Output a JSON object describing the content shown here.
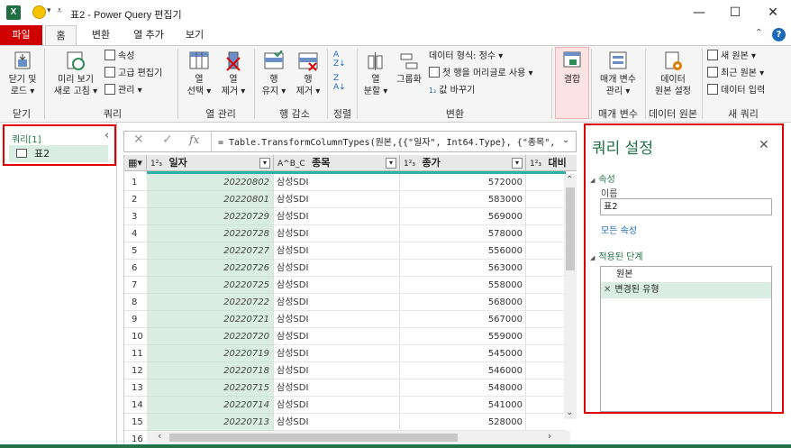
{
  "window": {
    "logo": "X",
    "title": "표2 - Power Query 편집기",
    "controls": {
      "minimize": "—",
      "maximize": "☐",
      "close": "✕"
    }
  },
  "tabs": [
    {
      "label": "파일"
    },
    {
      "label": "홈"
    },
    {
      "label": "변환"
    },
    {
      "label": "열 추가"
    },
    {
      "label": "보기"
    }
  ],
  "ribbon": {
    "close_group": {
      "btn_line1": "닫기 및",
      "btn_line2": "로드 ▾",
      "label": "닫기"
    },
    "query_group": {
      "preview_line1": "미리 보기",
      "preview_line2": "새로 고침 ▾",
      "properties": "속성",
      "advanced_editor": "고급 편집기",
      "manage": "관리 ▾",
      "label": "쿼리"
    },
    "column_group": {
      "select_line1": "열",
      "select_line2": "선택 ▾",
      "remove_line1": "열",
      "remove_line2": "제거 ▾",
      "label": "열 관리"
    },
    "row_group": {
      "keep_line1": "행",
      "keep_line2": "유지 ▾",
      "remove_line1": "행",
      "remove_line2": "제거 ▾",
      "label": "행 감소"
    },
    "sort_group": {
      "label": "정렬"
    },
    "transform_group": {
      "split_line1": "열",
      "split_line2": "분할 ▾",
      "groupby": "그룹화",
      "data_type": "데이터 형식: 정수 ▾",
      "first_row_header": "첫 행을 머리글로 사용 ▾",
      "replace_values": "값 바꾸기",
      "label": "변환"
    },
    "combine_group": {
      "btn": "결합",
      "label": ""
    },
    "param_group": {
      "line1": "매개 변수",
      "line2": "관리 ▾",
      "label": "매개 변수"
    },
    "datasource_group": {
      "line1": "데이터",
      "line2": "원본 설정",
      "label": "데이터 원본"
    },
    "newquery_group": {
      "new_source": "새 원본 ▾",
      "recent_sources": "최근 원본 ▾",
      "enter_data": "데이터 입력",
      "label": "새 쿼리"
    }
  },
  "queries_panel": {
    "header": "쿼리[1]",
    "items": [
      {
        "name": "표2"
      }
    ]
  },
  "formula_bar": {
    "cancel": "✕",
    "commit": "✓",
    "fx": "fx",
    "formula": "= Table.TransformColumnTypes(원본,{{\"일자\", Int64.Type}, {\"종목\","
  },
  "grid": {
    "columns": [
      {
        "type_icon": "1²₃",
        "name": "일자"
      },
      {
        "type_icon": "A^B_C",
        "name": "종목"
      },
      {
        "type_icon": "1²₃",
        "name": "종가"
      },
      {
        "type_icon": "1²₃",
        "name": "대비"
      }
    ],
    "rows": [
      [
        "1",
        "20220802",
        "삼성SDI",
        "572000"
      ],
      [
        "2",
        "20220801",
        "삼성SDI",
        "583000"
      ],
      [
        "3",
        "20220729",
        "삼성SDI",
        "569000"
      ],
      [
        "4",
        "20220728",
        "삼성SDI",
        "578000"
      ],
      [
        "5",
        "20220727",
        "삼성SDI",
        "556000"
      ],
      [
        "6",
        "20220726",
        "삼성SDI",
        "563000"
      ],
      [
        "7",
        "20220725",
        "삼성SDI",
        "558000"
      ],
      [
        "8",
        "20220722",
        "삼성SDI",
        "568000"
      ],
      [
        "9",
        "20220721",
        "삼성SDI",
        "567000"
      ],
      [
        "10",
        "20220720",
        "삼성SDI",
        "559000"
      ],
      [
        "11",
        "20220719",
        "삼성SDI",
        "545000"
      ],
      [
        "12",
        "20220718",
        "삼성SDI",
        "546000"
      ],
      [
        "13",
        "20220715",
        "삼성SDI",
        "548000"
      ],
      [
        "14",
        "20220714",
        "삼성SDI",
        "541000"
      ],
      [
        "15",
        "20220713",
        "삼성SDI",
        "528000"
      ],
      [
        "16",
        "20220712",
        "",
        ""
      ]
    ]
  },
  "query_settings": {
    "title": "쿼리 설정",
    "close": "✕",
    "properties_header": "속성",
    "name_label": "이름",
    "name_value": "표2",
    "all_properties": "모든 속성",
    "applied_steps_header": "적용된 단계",
    "steps": [
      {
        "label": "원본",
        "icon": ""
      },
      {
        "label": "변경된 유형",
        "icon": "✕"
      }
    ]
  },
  "colors": {
    "accent_green": "#217346",
    "highlight_green": "#d9ede3",
    "file_tab_red": "#d00000",
    "annotation_red": "#e00000",
    "link_blue": "#1a68b9"
  }
}
